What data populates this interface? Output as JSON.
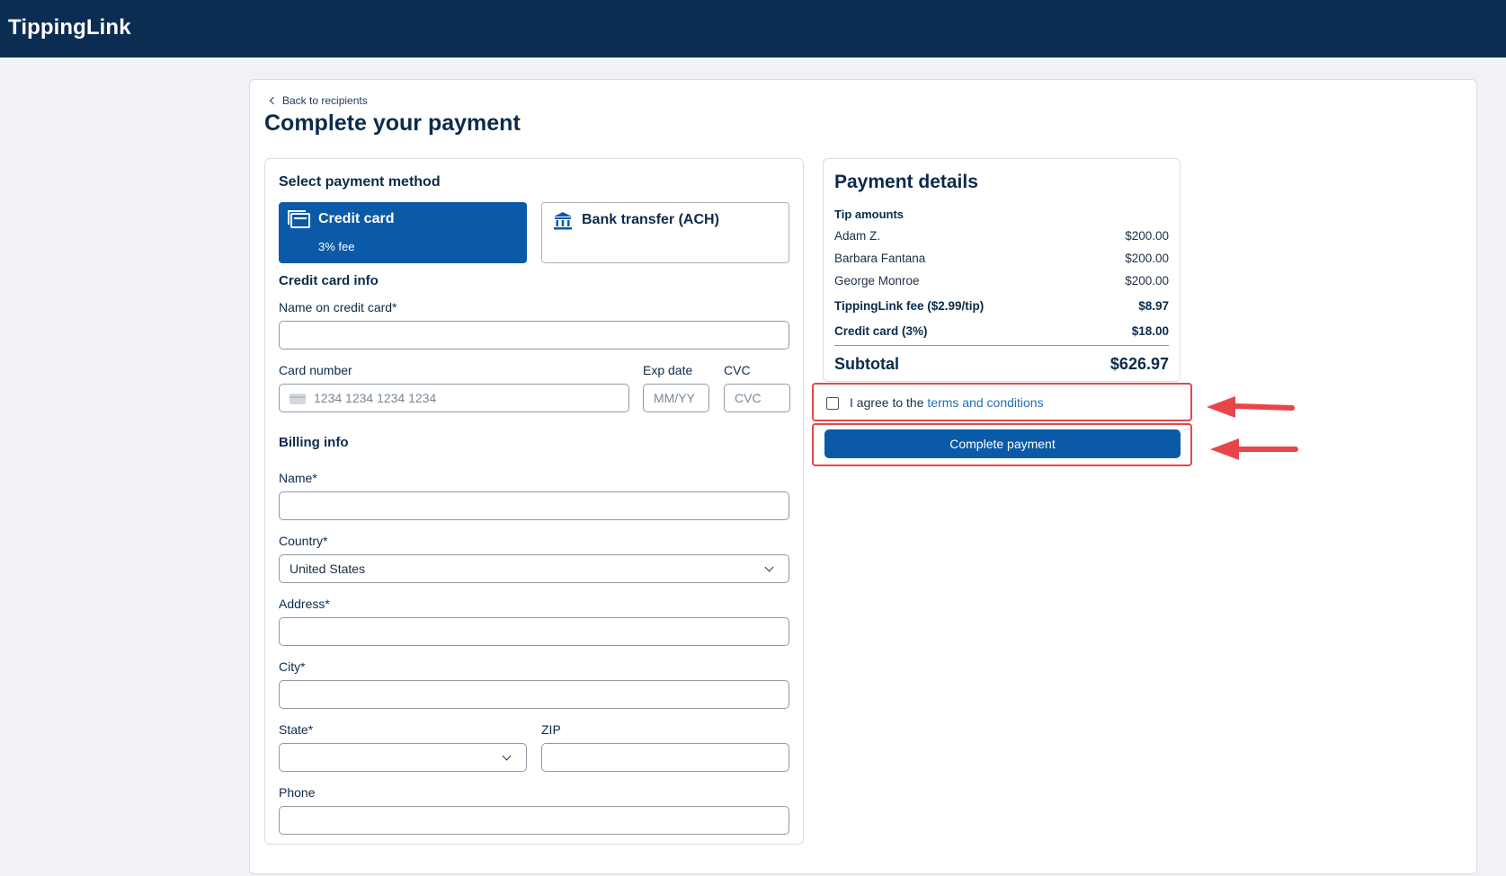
{
  "app": {
    "brand": "TippingLink"
  },
  "page": {
    "back_label": "Back to recipients",
    "title": "Complete your payment"
  },
  "payment_method": {
    "heading": "Select payment method",
    "options": [
      {
        "name": "Credit card",
        "fee": "3% fee",
        "selected": true
      },
      {
        "name": "Bank transfer (ACH)",
        "fee": "",
        "selected": false
      }
    ]
  },
  "credit_card_info": {
    "heading": "Credit card info",
    "name_label": "Name on credit card*",
    "number_label": "Card number",
    "number_placeholder": "1234 1234 1234 1234",
    "exp_label": "Exp date",
    "exp_placeholder": "MM/YY",
    "cvc_label": "CVC",
    "cvc_placeholder": "CVC"
  },
  "billing_info": {
    "heading": "Billing info",
    "name_label": "Name*",
    "country_label": "Country*",
    "country_value": "United States",
    "address_label": "Address*",
    "city_label": "City*",
    "state_label": "State*",
    "zip_label": "ZIP",
    "phone_label": "Phone"
  },
  "payment_details": {
    "heading": "Payment details",
    "tip_heading": "Tip amounts",
    "tips": [
      {
        "name": "Adam Z.",
        "amount": "$200.00"
      },
      {
        "name": "Barbara Fantana",
        "amount": "$200.00"
      },
      {
        "name": "George Monroe",
        "amount": "$200.00"
      }
    ],
    "fee_label": "TippingLink fee ($2.99/tip)",
    "fee_amount": "$8.97",
    "cc_label": "Credit card (3%)",
    "cc_amount": "$18.00",
    "subtotal_label": "Subtotal",
    "subtotal_amount": "$626.97"
  },
  "agreement": {
    "prefix": "I agree to the ",
    "link": "terms and conditions"
  },
  "actions": {
    "pay_label": "Complete payment"
  },
  "colors": {
    "nav": "#0b2d52",
    "primary": "#0b5aa8",
    "highlight": "#e8454a",
    "link": "#1f6fb8"
  }
}
